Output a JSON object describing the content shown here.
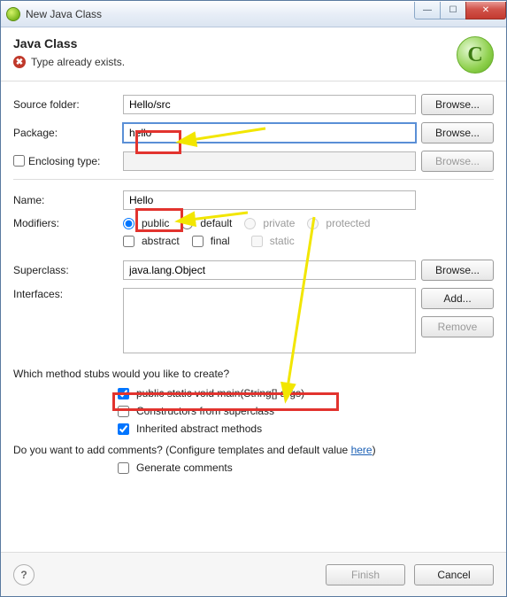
{
  "window": {
    "title": "New Java Class"
  },
  "header": {
    "title": "Java Class",
    "error": "Type already exists.",
    "badge": "C"
  },
  "form": {
    "sourceFolder": {
      "label": "Source folder:",
      "value": "Hello/src",
      "browse": "Browse..."
    },
    "package": {
      "label": "Package:",
      "value": "hello",
      "browse": "Browse..."
    },
    "enclosing": {
      "label": "Enclosing type:",
      "value": "",
      "browse": "Browse..."
    },
    "name": {
      "label": "Name:",
      "value": "Hello"
    },
    "modifiersLabel": "Modifiers:",
    "modifiers": {
      "public": "public",
      "default": "default",
      "private": "private",
      "protected": "protected",
      "abstract": "abstract",
      "final": "final",
      "static": "static"
    },
    "superclass": {
      "label": "Superclass:",
      "value": "java.lang.Object",
      "browse": "Browse..."
    },
    "interfaces": {
      "label": "Interfaces:",
      "add": "Add...",
      "remove": "Remove"
    },
    "stubs": {
      "question": "Which method stubs would you like to create?",
      "main": "public static void main(String[] args)",
      "constructors": "Constructors from superclass",
      "inherited": "Inherited abstract methods"
    },
    "comments": {
      "question_pre": "Do you want to add comments? (Configure templates and default value ",
      "here": "here",
      "question_post": ")",
      "generate": "Generate comments"
    }
  },
  "footer": {
    "help": "?",
    "finish": "Finish",
    "cancel": "Cancel"
  }
}
